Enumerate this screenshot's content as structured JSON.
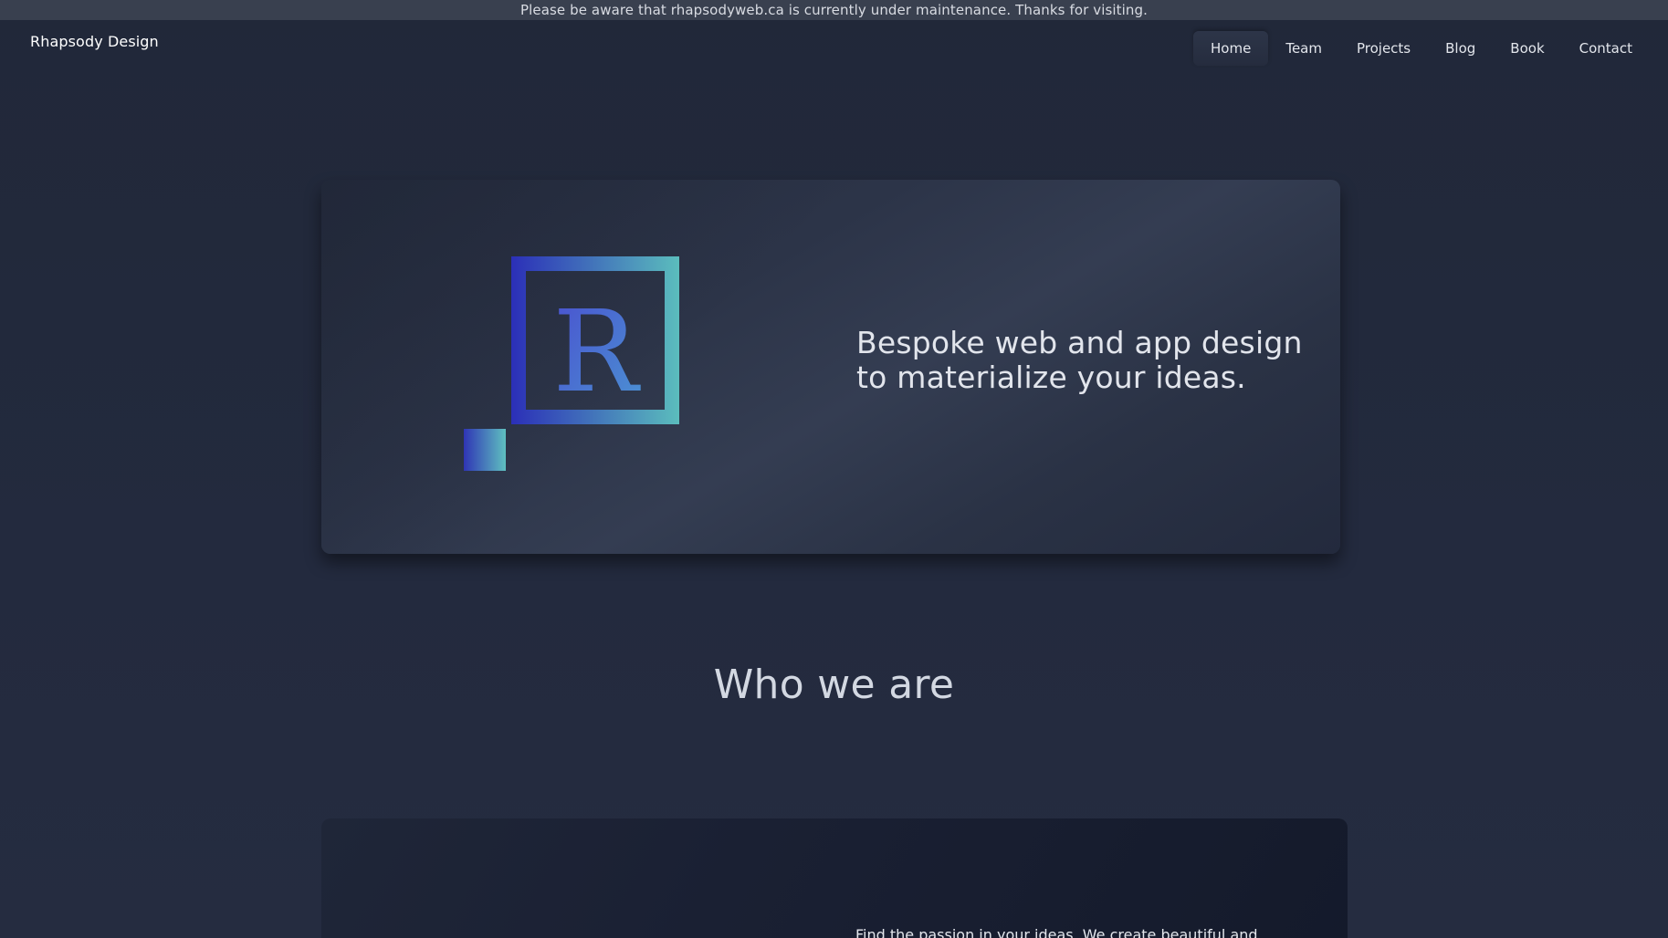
{
  "banner": {
    "text": "Please be aware that rhapsodyweb.ca is currently under maintenance. Thanks for visiting."
  },
  "header": {
    "brand": "Rhapsody Design",
    "nav": [
      {
        "label": "Home",
        "active": true
      },
      {
        "label": "Team",
        "active": false
      },
      {
        "label": "Projects",
        "active": false
      },
      {
        "label": "Blog",
        "active": false
      },
      {
        "label": "Book",
        "active": false
      },
      {
        "label": "Contact",
        "active": false
      }
    ]
  },
  "hero": {
    "logo_letter": "R",
    "logo_icon": "rhapsody-r-logo-icon",
    "tagline_line1": "Bespoke web and app design",
    "tagline_line2": "to materialize your ideas."
  },
  "about": {
    "heading": "Who we are",
    "text": "Find the passion in your ideas. We create beautiful and"
  },
  "colors": {
    "background": "#222a3d",
    "banner_bg": "#39404f",
    "logo_gradient_start": "#2b2fb8",
    "logo_gradient_end": "#5bbdbd"
  }
}
